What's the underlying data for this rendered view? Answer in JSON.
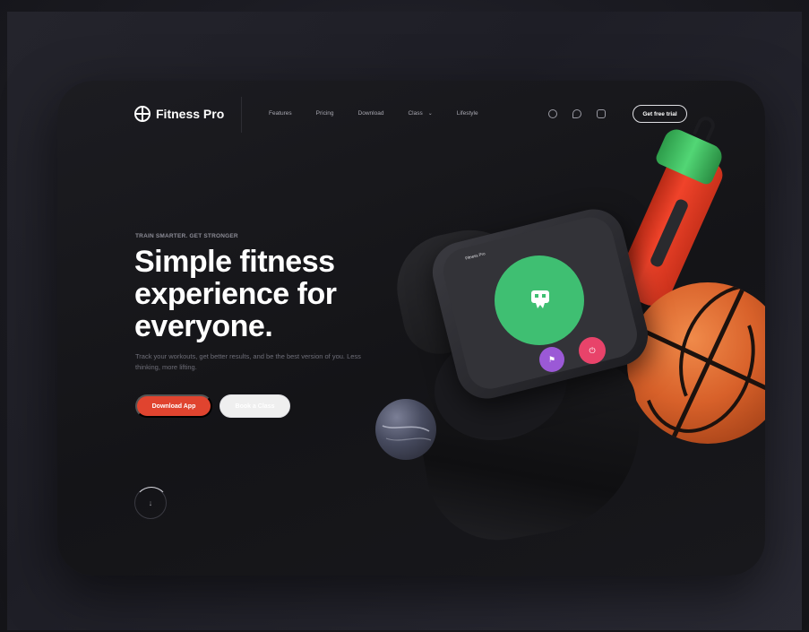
{
  "header": {
    "brand": "Fitness Pro",
    "nav": [
      {
        "label": "Features"
      },
      {
        "label": "Pricing"
      },
      {
        "label": "Download"
      },
      {
        "label": "Class",
        "has_dropdown": true
      },
      {
        "label": "Lifestyle"
      }
    ],
    "socials": [
      "dribbble-icon",
      "twitter-icon",
      "instagram-icon"
    ],
    "cta_label": "Get free trial"
  },
  "hero": {
    "eyebrow": "TRAIN SMARTER. GET STRONGER",
    "headline": "Simple fitness experience for everyone.",
    "subtext": "Track your workouts, get better results, and be the best version of you. Less thinking, more lifting.",
    "primary_button": "Download App",
    "secondary_button": "Book a Class",
    "scroll_icon": "↓"
  },
  "watch": {
    "screen_title": "Fitness Pro",
    "flag_icon": "⚑",
    "power_icon": "⏻"
  },
  "colors": {
    "accent": "#e0442f",
    "green": "#3fbf72",
    "purple": "#9b59d6",
    "pink": "#e8436a",
    "background": "#141417"
  }
}
